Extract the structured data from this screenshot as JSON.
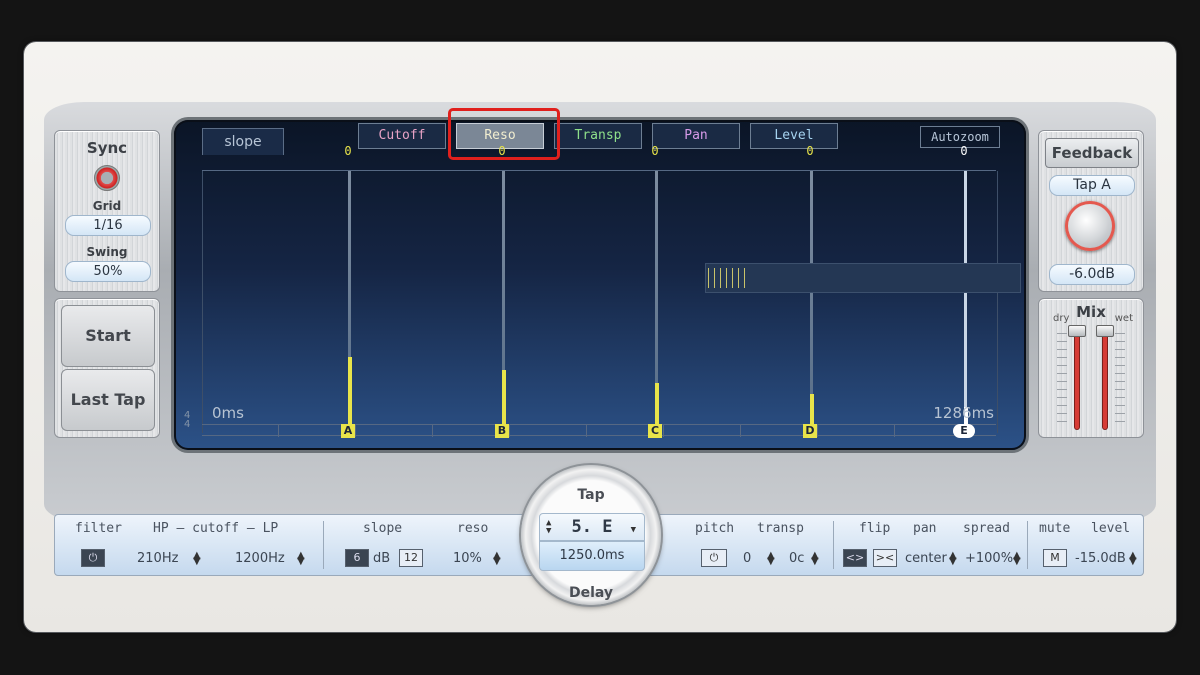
{
  "left": {
    "sync_label": "Sync",
    "grid_label": "Grid",
    "grid_value": "1/16",
    "swing_label": "Swing",
    "swing_value": "50%",
    "start_label": "Start",
    "last_tap_label": "Last Tap"
  },
  "right": {
    "feedback_label": "Feedback",
    "tap_select": "Tap A",
    "feedback_value": "-6.0dB",
    "mix_label": "Mix",
    "dry_label": "dry",
    "wet_label": "wet"
  },
  "display": {
    "slope_tab": "slope",
    "views": [
      "Cutoff",
      "Reso",
      "Transp",
      "Pan",
      "Level"
    ],
    "view_colors": [
      "#e8a3c6",
      "#f2eed0",
      "#8fe08a",
      "#d79ae8",
      "#a6d3f0"
    ],
    "selected_view": "Reso",
    "autozoom_label": "Autozoom",
    "time_start": "0ms",
    "time_end": "1286ms",
    "meter_top": "4",
    "meter_bottom": "4",
    "taps": [
      {
        "letter": "A",
        "value": "0",
        "level": 0.29
      },
      {
        "letter": "B",
        "value": "0",
        "level": 0.24
      },
      {
        "letter": "C",
        "value": "0",
        "level": 0.19
      },
      {
        "letter": "D",
        "value": "0",
        "level": 0.15
      },
      {
        "letter": "E",
        "value": "0",
        "level": 0.1
      }
    ],
    "selected_tap": "E"
  },
  "tap_control": {
    "title": "Tap",
    "selected": "5. E",
    "delay_value": "1250.0ms",
    "delay_label": "Delay"
  },
  "params": {
    "filter_label": "filter",
    "hp_lp_label": "HP – cutoff – LP",
    "hp_value": "210Hz",
    "lp_value": "1200Hz",
    "slope_label": "slope",
    "slope_value": "6",
    "slope_unit": "dB",
    "slope_alt": "12",
    "reso_label": "reso",
    "reso_value": "10%",
    "pitch_label": "pitch",
    "transp_label": "transp",
    "transp_semitones": "0",
    "transp_cents": "0c",
    "flip_label": "flip",
    "pan_label": "pan",
    "spread_label": "spread",
    "pan_value": "center",
    "spread_value": "+100%",
    "mute_label": "mute",
    "level_label": "level",
    "mute_value": "M",
    "level_value": "-15.0dB"
  }
}
